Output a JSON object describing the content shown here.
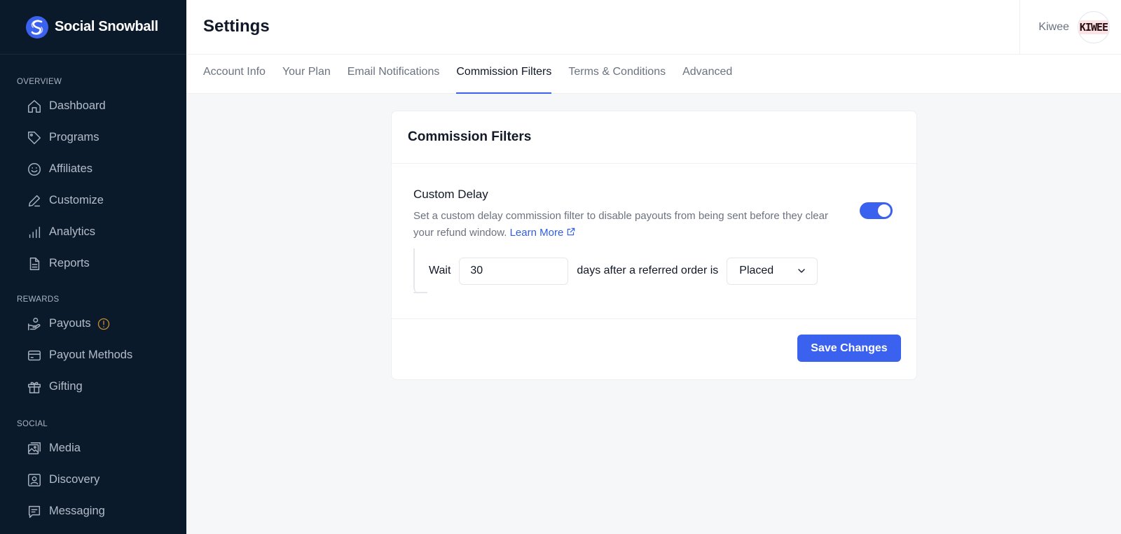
{
  "brand": {
    "name": "Social Snowball",
    "logo_icon": "snowball-s-logo",
    "accent": "#3b62ef"
  },
  "sidebar": {
    "sections": [
      {
        "label": "OVERVIEW",
        "items": [
          {
            "label": "Dashboard",
            "icon": "home-icon"
          },
          {
            "label": "Programs",
            "icon": "tag-icon"
          },
          {
            "label": "Affiliates",
            "icon": "smile-icon"
          },
          {
            "label": "Customize",
            "icon": "pen-icon"
          },
          {
            "label": "Analytics",
            "icon": "bar-chart-icon"
          },
          {
            "label": "Reports",
            "icon": "document-icon"
          }
        ]
      },
      {
        "label": "REWARDS",
        "items": [
          {
            "label": "Payouts",
            "icon": "hand-coin-icon",
            "badge_icon": "warning-icon"
          },
          {
            "label": "Payout Methods",
            "icon": "credit-card-icon"
          },
          {
            "label": "Gifting",
            "icon": "gift-icon"
          }
        ]
      },
      {
        "label": "SOCIAL",
        "items": [
          {
            "label": "Media",
            "icon": "images-icon"
          },
          {
            "label": "Discovery",
            "icon": "user-square-icon"
          },
          {
            "label": "Messaging",
            "icon": "message-icon"
          }
        ]
      }
    ]
  },
  "header": {
    "title": "Settings",
    "user_name": "Kiwee",
    "avatar_text": "KIWEE"
  },
  "tabs": [
    {
      "label": "Account Info",
      "active": false
    },
    {
      "label": "Your Plan",
      "active": false
    },
    {
      "label": "Email Notifications",
      "active": false
    },
    {
      "label": "Commission Filters",
      "active": true
    },
    {
      "label": "Terms & Conditions",
      "active": false
    },
    {
      "label": "Advanced",
      "active": false
    }
  ],
  "card": {
    "title": "Commission Filters",
    "setting": {
      "title": "Custom Delay",
      "description": "Set a custom delay commission filter to disable payouts from being sent before they clear your refund window.",
      "learn_more": "Learn More",
      "enabled": true,
      "wait_label": "Wait",
      "days_value": "30",
      "after_label": "days after a referred order is",
      "status_selected": "Placed"
    },
    "save_label": "Save Changes"
  }
}
